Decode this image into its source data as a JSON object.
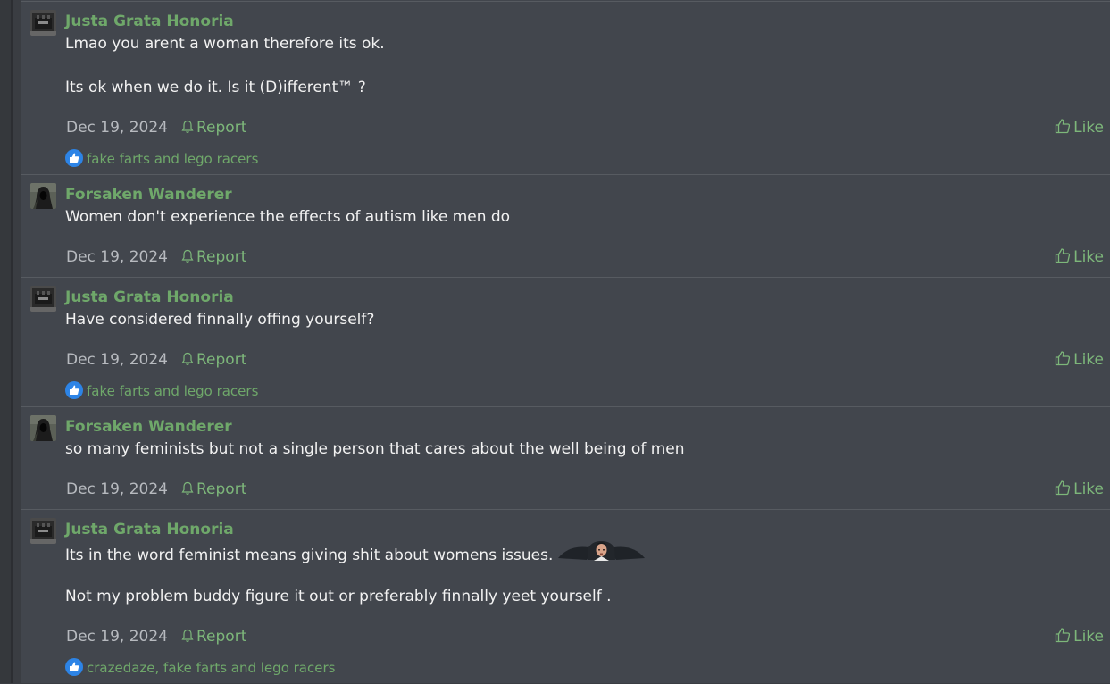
{
  "posts": [
    {
      "author": "Justa Grata Honoria",
      "avatar_icon": "dark-castle-avatar",
      "lines": [
        "Lmao you arent a woman therefore its ok.",
        "Its ok when we do it. Is it (D)ifferent™ ?"
      ],
      "date": "Dec 19, 2024",
      "report_label": "Report",
      "like_label": "Like",
      "reactions": "fake farts and lego racers"
    },
    {
      "author": "Forsaken Wanderer",
      "avatar_icon": "hooded-figure-avatar",
      "lines": [
        "Women don't experience the effects of autism like men do"
      ],
      "date": "Dec 19, 2024",
      "report_label": "Report",
      "like_label": "Like"
    },
    {
      "author": "Justa Grata Honoria",
      "avatar_icon": "dark-castle-avatar",
      "lines": [
        "Have considered finnally offing yourself?"
      ],
      "date": "Dec 19, 2024",
      "report_label": "Report",
      "like_label": "Like",
      "reactions": "fake farts and lego racers"
    },
    {
      "author": "Forsaken Wanderer",
      "avatar_icon": "hooded-figure-avatar",
      "lines": [
        "so many feminists but not a single person that cares about the well being of men"
      ],
      "date": "Dec 19, 2024",
      "report_label": "Report",
      "like_label": "Like"
    },
    {
      "author": "Justa Grata Honoria",
      "avatar_icon": "dark-castle-avatar",
      "lines": [
        "Its in the word feminist means giving shit about womens issues.",
        "Not my problem buddy figure it out or preferably finnally yeet yourself ."
      ],
      "emote_icon": "stressed-person-emote",
      "date": "Dec 19, 2024",
      "report_label": "Report",
      "like_label": "Like",
      "reactions": "crazedaze, fake farts and lego racers"
    }
  ],
  "colors": {
    "background": "#42464d",
    "username": "#6fa86a",
    "link": "#7db77a",
    "text": "#f2f2f2",
    "muted": "#b7babf",
    "reaction_badge": "#2d84e6"
  }
}
